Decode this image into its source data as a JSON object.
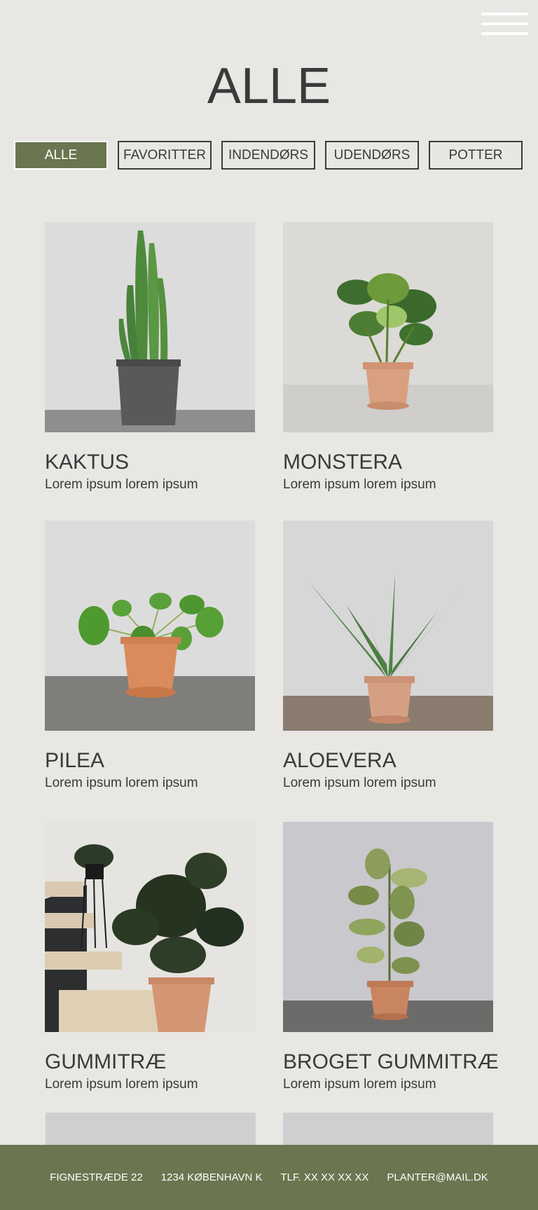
{
  "menu": {
    "icon": "hamburger-icon"
  },
  "header": {
    "title": "ALLE"
  },
  "filters": [
    {
      "label": "ALLE",
      "active": true
    },
    {
      "label": "FAVORITTER",
      "active": false
    },
    {
      "label": "INDENDØRS",
      "active": false
    },
    {
      "label": "UDENDØRS",
      "active": false
    },
    {
      "label": "POTTER",
      "active": false
    }
  ],
  "products": [
    {
      "name": "KAKTUS",
      "description": "Lorem ipsum lorem ipsum",
      "image": "cactus-photo"
    },
    {
      "name": "MONSTERA",
      "description": "Lorem ipsum lorem ipsum",
      "image": "monstera-photo"
    },
    {
      "name": "PILEA",
      "description": "Lorem ipsum lorem ipsum",
      "image": "pilea-photo"
    },
    {
      "name": "ALOEVERA",
      "description": "Lorem ipsum lorem ipsum",
      "image": "aloe-vera-photo"
    },
    {
      "name": "GUMMITRÆ",
      "description": "Lorem ipsum lorem ipsum",
      "image": "rubber-tree-photo"
    },
    {
      "name": "BROGET GUMMITRÆ",
      "description": "Lorem ipsum lorem ipsum",
      "image": "variegated-rubber-tree-photo"
    }
  ],
  "footer": {
    "address": "FIGNESTRÆDE 22",
    "city": "1234 KØBENHAVN K",
    "phone": "TLF. XX XX XX XX",
    "email": "PLANTER@MAIL.DK"
  },
  "colors": {
    "background": "#e8e7e4",
    "accent": "#69764f",
    "text": "#3a3a3a"
  }
}
